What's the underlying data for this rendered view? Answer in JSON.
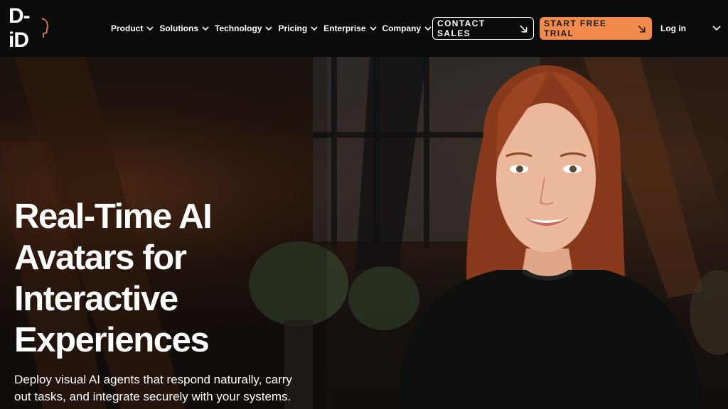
{
  "brand": {
    "logo_text": "D-iD"
  },
  "nav": {
    "items": [
      {
        "label": "Product"
      },
      {
        "label": "Solutions"
      },
      {
        "label": "Technology"
      },
      {
        "label": "Pricing"
      },
      {
        "label": "Enterprise"
      },
      {
        "label": "Company"
      }
    ],
    "contact_label": "CONTACT SALES",
    "trial_label": "START FREE TRIAL",
    "login_label": "Log in"
  },
  "hero": {
    "headline_lines": [
      "Real-Time AI",
      "Avatars for",
      "Interactive",
      "Experiences"
    ],
    "subtext": "Deploy visual AI agents that respond naturally, carry out tasks, and integrate securely with your systems."
  },
  "icons": {
    "chevron": "chevron-down-icon",
    "arrow": "arrow-down-right-icon"
  },
  "colors": {
    "accent": "#f28a4c",
    "header_bg": "#0b0b0b",
    "text": "#ffffff"
  }
}
